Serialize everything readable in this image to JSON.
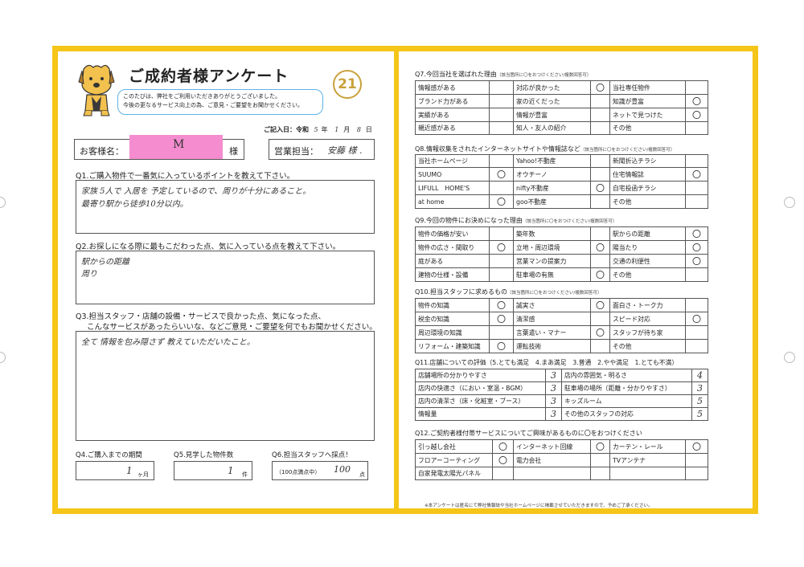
{
  "header": {
    "title": "ご成約者様アンケート",
    "greeting": [
      "このたびは、弊社をご利用いただきありがとうございました。",
      "今後の更なるサービス向上の為、ご意見・ご要望をお聞かせください。"
    ],
    "logo_number": "21",
    "date_label": "ご記入日：令和",
    "date_year": "5",
    "date_year_unit": "年",
    "date_month": "1",
    "date_month_unit": "月",
    "date_day": "8",
    "date_day_unit": "日"
  },
  "customer": {
    "label": "お客様名：",
    "name": "M",
    "honorific": "様",
    "staff_label": "営業担当：",
    "staff_name": "安藤 様 ."
  },
  "q1": {
    "question": "Q1.ご購入物件で一番気に入っているポイントを教えて下さい。",
    "answer_line1": "家族 5人で 入居を 予定しているので、周りが十分にあること。",
    "answer_line2": "最寄り駅から徒歩10分以内。"
  },
  "q2": {
    "question": "Q2.お探しになる際に最もこだわった点、気に入っている点を教えて下さい。",
    "answer_line1": "駅からの距離",
    "answer_line2": "周り"
  },
  "q3": {
    "question_line1": "Q3.担当スタッフ・店舗の設備・サービスで良かった点、気になった点、",
    "question_line2": "こんなサービスがあったらいいな、などご意見・ご要望を何でもお聞かせください。",
    "answer": "全て 情報を包み隠さず 教えていただいたこと。"
  },
  "q4": {
    "label": "Q4.ご購入までの期間",
    "value": "1",
    "unit": "ヶ月"
  },
  "q5": {
    "label": "Q5.見学した物件数",
    "value": "1",
    "unit": "件"
  },
  "q6": {
    "label": "Q6.担当スタッフへ採点！",
    "prefix": "（100点満点中）",
    "value": "100",
    "unit": "点"
  },
  "q7": {
    "title": "Q7.今回当社を選ばれた理由",
    "note": "（該当箇所に〇をおつけください/複数回答可）",
    "rows": [
      [
        {
          "t": "情報感がある",
          "c": ""
        },
        {
          "t": "対応が良かった",
          "c": "〇"
        },
        {
          "t": "当社専任物件",
          "c": ""
        }
      ],
      [
        {
          "t": "ブランド力がある",
          "c": ""
        },
        {
          "t": "家の近くだった",
          "c": ""
        },
        {
          "t": "知識が豊富",
          "c": "〇"
        }
      ],
      [
        {
          "t": "実績がある",
          "c": ""
        },
        {
          "t": "情報が豊富",
          "c": ""
        },
        {
          "t": "ネットで見つけた",
          "c": "〇"
        }
      ],
      [
        {
          "t": "親近感がある",
          "c": ""
        },
        {
          "t": "知人・友人の紹介",
          "c": ""
        },
        {
          "t": "その他",
          "c": ""
        }
      ]
    ]
  },
  "q8": {
    "title": "Q8.情報収集をされたインターネットサイトや情報誌など",
    "note": "（該当箇所に〇をおつけください/複数回答可）",
    "rows": [
      [
        {
          "t": "当社ホームページ",
          "c": ""
        },
        {
          "t": "Yahoo!不動産",
          "c": ""
        },
        {
          "t": "新聞折込チラシ",
          "c": ""
        }
      ],
      [
        {
          "t": "SUUMO",
          "c": "〇"
        },
        {
          "t": "オウチーノ",
          "c": ""
        },
        {
          "t": "住宅情報誌",
          "c": "〇"
        }
      ],
      [
        {
          "t": "LIFULL　HOME'S",
          "c": ""
        },
        {
          "t": "nifty不動産",
          "c": "〇"
        },
        {
          "t": "自宅投函チラシ",
          "c": ""
        }
      ],
      [
        {
          "t": "at home",
          "c": "〇"
        },
        {
          "t": "goo不動産",
          "c": ""
        },
        {
          "t": "その他",
          "c": ""
        }
      ]
    ]
  },
  "q9": {
    "title": "Q9.今回の物件にお決めになった理由",
    "note": "（該当箇所に〇をおつけください/複数回答可）",
    "rows": [
      [
        {
          "t": "物件の価格が安い",
          "c": ""
        },
        {
          "t": "築年数",
          "c": ""
        },
        {
          "t": "駅からの距離",
          "c": "〇"
        }
      ],
      [
        {
          "t": "物件の広さ・間取り",
          "c": "〇"
        },
        {
          "t": "立地・周辺環境",
          "c": "〇"
        },
        {
          "t": "陽当たり",
          "c": "〇"
        }
      ],
      [
        {
          "t": "庭がある",
          "c": ""
        },
        {
          "t": "営業マンの提案力",
          "c": ""
        },
        {
          "t": "交通の利便性",
          "c": "〇"
        }
      ],
      [
        {
          "t": "建物の仕様・設備",
          "c": ""
        },
        {
          "t": "駐車場の有無",
          "c": "〇"
        },
        {
          "t": "その他",
          "c": ""
        }
      ]
    ]
  },
  "q10": {
    "title": "Q10.担当スタッフに求めるもの",
    "note": "（該当箇所に〇をおつけください/複数回答可）",
    "rows": [
      [
        {
          "t": "物件の知識",
          "c": "〇"
        },
        {
          "t": "誠実さ",
          "c": "〇"
        },
        {
          "t": "面白さ・トーク力",
          "c": ""
        }
      ],
      [
        {
          "t": "税金の知識",
          "c": "〇"
        },
        {
          "t": "清潔感",
          "c": ""
        },
        {
          "t": "スピード対応",
          "c": "〇"
        }
      ],
      [
        {
          "t": "周辺環境の知識",
          "c": ""
        },
        {
          "t": "言葉遣い・マナー",
          "c": "〇"
        },
        {
          "t": "スタッフが待ち家",
          "c": ""
        }
      ],
      [
        {
          "t": "リフォーム・建築知識",
          "c": "〇"
        },
        {
          "t": "運転技術",
          "c": ""
        },
        {
          "t": "その他",
          "c": ""
        }
      ]
    ]
  },
  "q11": {
    "title": "Q11.店舗についての評価（5.とても満足　4.まあ満足　3.普通　2.やや満足　1.とても不満）",
    "rows": [
      [
        {
          "t": "店舗場所の分かりやすさ",
          "v": "3"
        },
        {
          "t": "店内の雰囲気・明るさ",
          "v": "4"
        }
      ],
      [
        {
          "t": "店内の快適さ（におい・室温・BGM）",
          "v": "3"
        },
        {
          "t": "駐車場の場所（距離・分かりやすさ）",
          "v": "3"
        }
      ],
      [
        {
          "t": "店内の清潔さ（床・化粧室・ブース）",
          "v": "3"
        },
        {
          "t": "キッズルーム",
          "v": "5"
        }
      ],
      [
        {
          "t": "情報量",
          "v": "3"
        },
        {
          "t": "その他のスタッフの対応",
          "v": "5"
        }
      ]
    ]
  },
  "q12": {
    "title": "Q12.ご契約者様付帯サービスについてご興味があるものに〇をおつけください",
    "rows": [
      [
        {
          "t": "引っ越し会社",
          "c": "〇"
        },
        {
          "t": "インターネット回線",
          "c": "〇"
        },
        {
          "t": "カーテン・レール",
          "c": "〇"
        }
      ],
      [
        {
          "t": "フロアーコーティング",
          "c": "〇"
        },
        {
          "t": "電力会社",
          "c": ""
        },
        {
          "t": "TVアンテナ",
          "c": ""
        }
      ],
      [
        {
          "t": "自家発電太陽光パネル",
          "c": ""
        },
        {
          "t": "",
          "c": ""
        },
        {
          "t": "",
          "c": ""
        }
      ]
    ]
  },
  "footer": "※本アンケートは匿名にて弊社情報誌や当社ホームページに掲載させていただきますので、予めご了承ください。",
  "colors": {
    "frame": "#f5c518",
    "highlight": "#f48ccf",
    "bubble": "#5fb3e6"
  }
}
